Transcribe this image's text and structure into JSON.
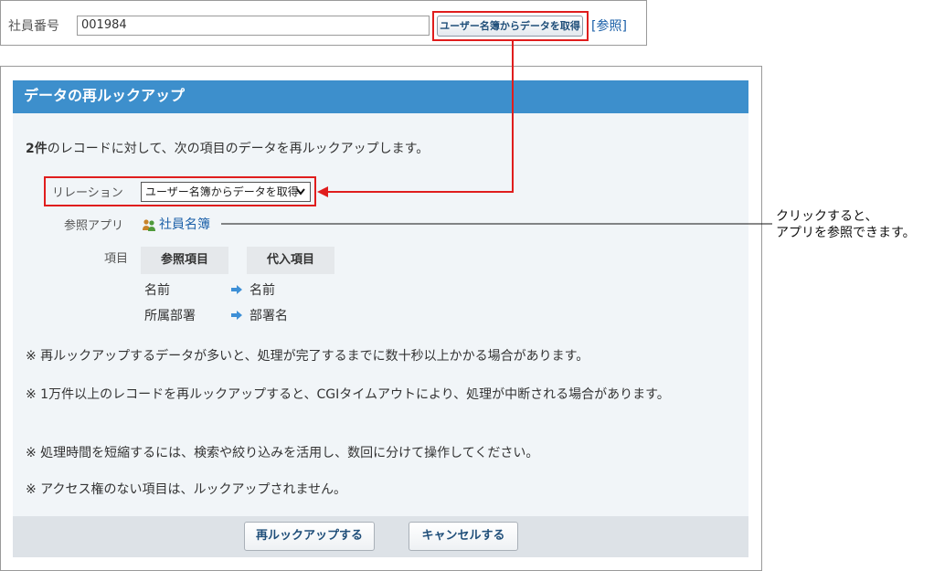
{
  "field": {
    "label": "社員番号",
    "value": "001984",
    "get_button": "ユーザー名簿からデータを取得",
    "ref_link": "[参照]"
  },
  "dialog": {
    "title": "データの再ルックアップ",
    "summary_count": "2件",
    "summary_text": "のレコードに対して、次の項目のデータを再ルックアップします。",
    "relation_label": "リレーション",
    "relation_value": "ユーザー名簿からデータを取得",
    "app_label": "参照アプリ",
    "app_name": "社員名簿",
    "items_label": "項目",
    "header_ref": "参照項目",
    "header_sub": "代入項目",
    "mappings": [
      {
        "ref": "名前",
        "sub": "名前"
      },
      {
        "ref": "所属部署",
        "sub": "部署名"
      }
    ],
    "notes": [
      "※ 再ルックアップするデータが多いと、処理が完了するまでに数十秒以上かかる場合があります。",
      "※ 1万件以上のレコードを再ルックアップすると、CGIタイムアウトにより、処理が中断される場合があります。",
      "※ 処理時間を短縮するには、検索や絞り込みを活用し、数回に分けて操作してください。",
      "※ アクセス権のない項目は、ルックアップされません。"
    ],
    "submit_button": "再ルックアップする",
    "cancel_button": "キャンセルする"
  },
  "callout": {
    "line1": "クリックすると、",
    "line2": "アプリを参照できます。"
  },
  "colors": {
    "header_bg": "#3d8fcc",
    "highlight": "#e01d1d",
    "link": "#1a5fa8",
    "body_bg": "#f1f5f8"
  }
}
